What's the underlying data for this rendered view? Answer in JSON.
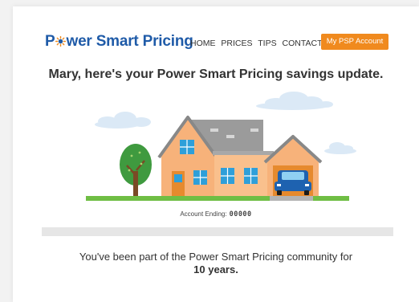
{
  "header": {
    "logo_text_a": "P",
    "logo_text_b": "wer Smart Pricing",
    "nav": [
      "HOME",
      "PRICES",
      "TIPS",
      "CONTACT"
    ],
    "account_button": "My PSP Account"
  },
  "headline": "Mary, here's your Power Smart Pricing savings update.",
  "account": {
    "label": "Account Ending:",
    "number": "00000"
  },
  "community": {
    "text": "You've been part of the Power Smart Pricing community for",
    "years": "10 years."
  },
  "colors": {
    "brand_blue": "#1f5ba8",
    "accent_orange": "#f08a1e",
    "house_body": "#f7b27a",
    "roof": "#999999",
    "grass": "#6fbe44",
    "window": "#2e9fd9"
  }
}
